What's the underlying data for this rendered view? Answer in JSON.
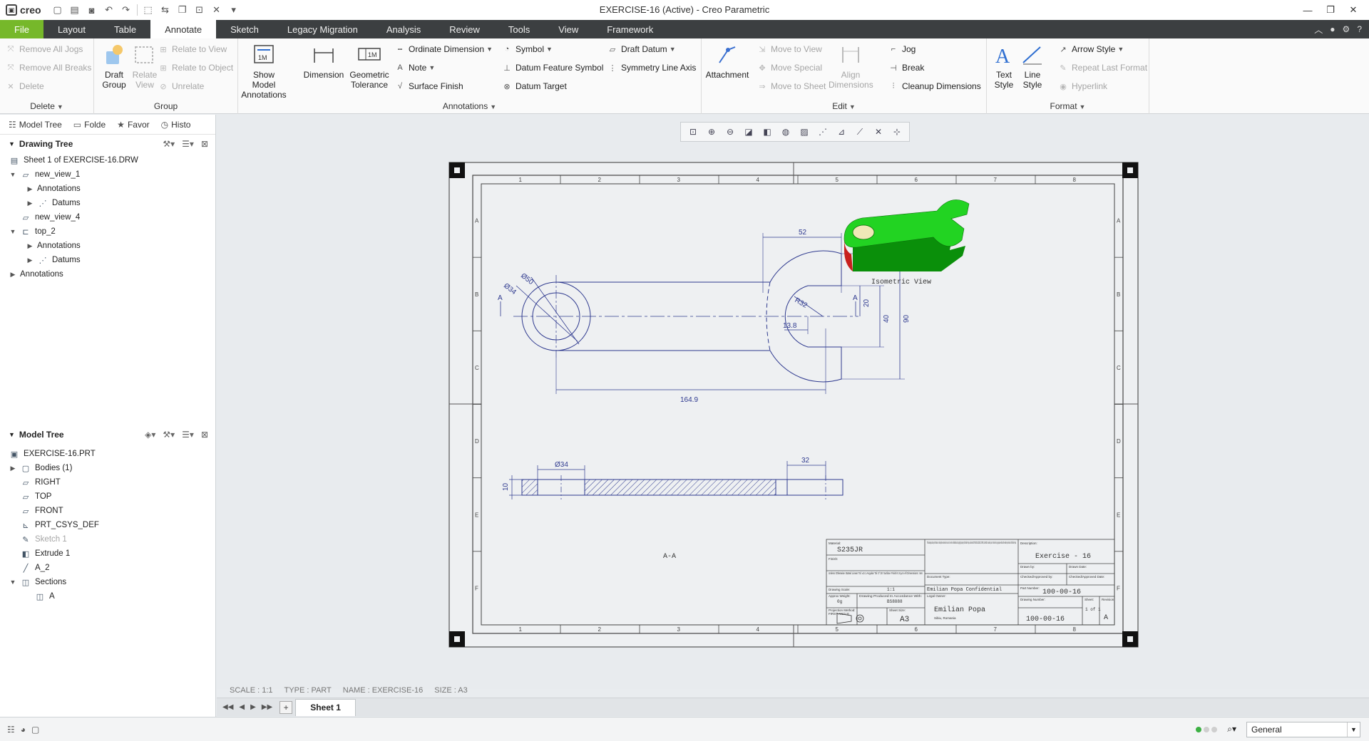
{
  "app": {
    "logo_text": "creo",
    "window_title": "EXERCISE-16 (Active) - Creo Parametric"
  },
  "tabs": [
    "File",
    "Layout",
    "Table",
    "Annotate",
    "Sketch",
    "Legacy Migration",
    "Analysis",
    "Review",
    "Tools",
    "View",
    "Framework"
  ],
  "active_tab": "Annotate",
  "ribbon": {
    "delete_group": {
      "label": "Delete",
      "items": [
        "Remove All Jogs",
        "Remove All Breaks",
        "Delete"
      ]
    },
    "group_group": {
      "label": "Group",
      "draft_group": "Draft Group",
      "relate_view": "Relate View",
      "items": [
        "Relate to View",
        "Relate to Object",
        "Unrelate"
      ]
    },
    "annotations_group": {
      "label": "Annotations",
      "show_model": "Show Model Annotations",
      "dimension": "Dimension",
      "geom_tol": "Geometric Tolerance",
      "col1": [
        "Ordinate Dimension",
        "Note",
        "Surface Finish"
      ],
      "col2": [
        "Symbol",
        "Datum Feature Symbol",
        "Datum Target"
      ],
      "col3": [
        "Draft Datum",
        "Symmetry Line Axis"
      ]
    },
    "edit_group": {
      "label": "Edit",
      "attachment": "Attachment",
      "move": [
        "Move to View",
        "Move Special",
        "Move to Sheet"
      ],
      "align": "Align Dimensions",
      "tools": [
        "Jog",
        "Break",
        "Cleanup Dimensions"
      ]
    },
    "format_group": {
      "label": "Format",
      "text_style": "Text Style",
      "line_style": "Line Style",
      "items": [
        "Arrow Style",
        "Repeat Last Format",
        "Hyperlink"
      ]
    }
  },
  "left_panel": {
    "nav_tabs": [
      "Model Tree",
      "Folde",
      "Favor",
      "Histo"
    ],
    "drawing_tree_title": "Drawing Tree",
    "drawing_tree": [
      {
        "label": "Sheet 1 of EXERCISE-16.DRW",
        "level": 0
      },
      {
        "label": "new_view_1",
        "level": 1
      },
      {
        "label": "Annotations",
        "level": 2
      },
      {
        "label": "Datums",
        "level": 2
      },
      {
        "label": "new_view_4",
        "level": 1
      },
      {
        "label": "top_2",
        "level": 1
      },
      {
        "label": "Annotations",
        "level": 2
      },
      {
        "label": "Datums",
        "level": 2
      },
      {
        "label": "Annotations",
        "level": 0
      }
    ],
    "model_tree_title": "Model Tree",
    "model_tree": [
      {
        "label": "EXERCISE-16.PRT"
      },
      {
        "label": "Bodies (1)"
      },
      {
        "label": "RIGHT"
      },
      {
        "label": "TOP"
      },
      {
        "label": "FRONT"
      },
      {
        "label": "PRT_CSYS_DEF"
      },
      {
        "label": "Sketch 1"
      },
      {
        "label": "Extrude 1"
      },
      {
        "label": "A_2"
      },
      {
        "label": "Sections"
      },
      {
        "label": "A"
      }
    ]
  },
  "drawing": {
    "zone_cols": [
      "1",
      "2",
      "3",
      "4",
      "5",
      "6",
      "7",
      "8"
    ],
    "zone_rows": [
      "A",
      "B",
      "C",
      "D",
      "E",
      "F"
    ],
    "dims": {
      "d52": "52",
      "d50": "Ø50",
      "d34": "Ø34",
      "r32": "R32",
      "d20": "20",
      "d40": "40",
      "d90": "90",
      "d13_8": "13.8",
      "d164_9": "164.9",
      "d34b": "Ø34",
      "d32": "32",
      "d10": "10",
      "datum_a": "A",
      "datum_a2": "A"
    },
    "iso_label": "Isometric View",
    "section_label": "A-A",
    "title_block": {
      "material_label": "Material:",
      "material": "S235JR",
      "finish_label": "Finish:",
      "tolerance_note": "Unless Otherwise Stated Linear Tol: ±0.1 Angular Tol: 0°15' Surface Finish 0.8 µm All Dimensions: mm",
      "drawing_scale_label": "Drawing Scale:",
      "drawing_scale": "1:1",
      "approx_weight_label": "Approx Weight:",
      "approx_weight": "0g",
      "produced_label": "Drawing Produced In Accordance With:",
      "produced": "BS8888",
      "projection_label": "Projection Method:",
      "projection": "FIRST ANGLE",
      "sheet_size_label": "Sheet Size:",
      "sheet_size": "A3",
      "confidential": "This drawing and any information or descriptive material set out on it are the confidential and copyright property of Emilian Popa, and must NOT BE DISCLOSED, COPIED, LOANED or used in part or whole for any purpose without the written permission of Emilian Popa",
      "doc_type_label": "Document Type:",
      "company": "Emilian Popa Confidential",
      "legal_owner_label": "Legal Owner:",
      "legal_owner": "Emilian Popa",
      "address": "Sibiu, Romania",
      "description_label": "Description:",
      "description": "Exercise - 16",
      "drawn_by_label": "Drawn by:",
      "drawn_date_label": "Drawn Date:",
      "checked_label": "Checked/Approved by:",
      "checked_date_label": "Checked/Approved Date:",
      "part_number_label": "Part Number:",
      "part_number": "100-00-16",
      "drawing_number_label": "Drawing Number:",
      "drawing_number": "100-00-16",
      "sheet_label": "Sheet:",
      "sheet": "1 of 1",
      "revision_label": "Revision:",
      "revision": "A"
    }
  },
  "status_info": {
    "scale": "SCALE : 1:1",
    "type": "TYPE : PART",
    "name": "NAME : EXERCISE-16",
    "size": "SIZE : A3"
  },
  "sheet_tab": "Sheet 1",
  "filter": "General",
  "colors": {
    "file_tab": "#76b82a",
    "tab_bar": "#3c3f41",
    "geometry": "#2f3a8f",
    "iso_green": "#1fd11f",
    "iso_red": "#c8201e"
  }
}
